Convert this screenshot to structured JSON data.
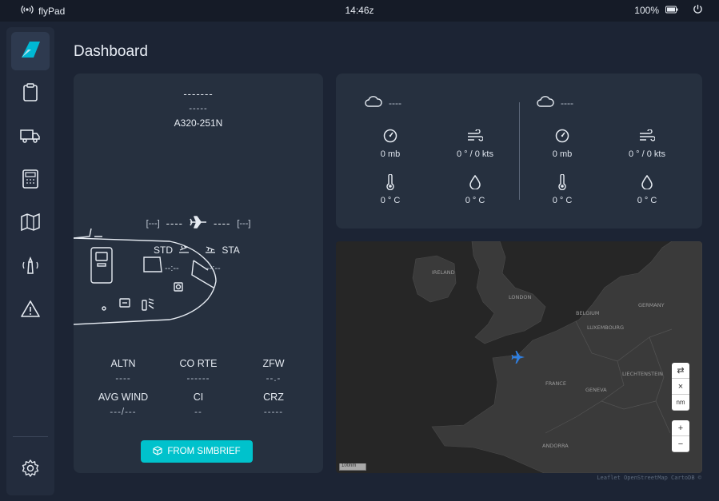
{
  "status_bar": {
    "app_name": "flyPad",
    "time": "14:46z",
    "battery": "100%",
    "icons": [
      "broadcast-icon",
      "battery-icon",
      "power-icon"
    ]
  },
  "sidebar": {
    "items": [
      {
        "name": "logo",
        "icon": "flybywire-logo-icon"
      },
      {
        "name": "dispatch",
        "icon": "clipboard-icon"
      },
      {
        "name": "ground",
        "icon": "truck-icon"
      },
      {
        "name": "performance",
        "icon": "calculator-icon"
      },
      {
        "name": "navigation",
        "icon": "map-icon"
      },
      {
        "name": "atc",
        "icon": "tower-icon"
      },
      {
        "name": "failures",
        "icon": "warning-icon"
      },
      {
        "name": "settings",
        "icon": "gear-icon"
      }
    ]
  },
  "page": {
    "title": "Dashboard"
  },
  "flight": {
    "flight_number": "-------",
    "sub_number": "-----",
    "aircraft": "A320-251N",
    "origin": "[---]",
    "destination": "[---]",
    "route_dash_left": "----",
    "route_dash_right": "----",
    "std_label": "STD",
    "sta_label": "STA",
    "std_value": "--:--",
    "sta_value": "--:--",
    "info": [
      {
        "label": "ALTN",
        "value": "----"
      },
      {
        "label": "CO RTE",
        "value": "------"
      },
      {
        "label": "ZFW",
        "value": "--.-"
      },
      {
        "label": "AVG WIND",
        "value": "---/---"
      },
      {
        "label": "CI",
        "value": "--"
      },
      {
        "label": "CRZ",
        "value": "-----"
      }
    ],
    "simbrief_button": "FROM SIMBRIEF"
  },
  "weather": [
    {
      "station": "----",
      "pressure": "0 mb",
      "wind": "0 ° / 0 kts",
      "temperature": "0 ° C",
      "dewpoint": "0 ° C"
    },
    {
      "station": "----",
      "pressure": "0 mb",
      "wind": "0 ° / 0 kts",
      "temperature": "0 ° C",
      "dewpoint": "0 ° C"
    }
  ],
  "map": {
    "labels": [
      "IRELAND",
      "LONDON",
      "BELGIUM",
      "GERMANY",
      "LUXEMBOURG",
      "FRANCE",
      "GENEVA",
      "LIECHTENSTEIN",
      "ANDORRA"
    ],
    "controls": {
      "swap": "⇄",
      "close": "×",
      "unit": "nm",
      "zoom_in": "+",
      "zoom_out": "−"
    },
    "scale": "100nm",
    "attribution": "Leaflet OpenStreetMap CartoDB ©",
    "aircraft_color": "#2f7fe0"
  },
  "colors": {
    "accent": "#00c2cc",
    "background": "#1c2434",
    "card": "#26303f"
  }
}
